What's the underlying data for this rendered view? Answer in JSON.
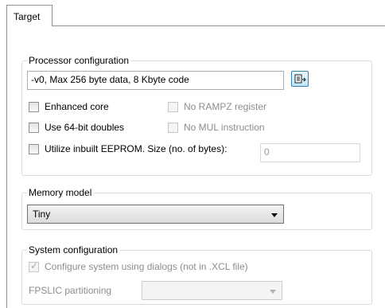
{
  "tab": {
    "label": "Target"
  },
  "processor": {
    "legend": "Processor configuration",
    "value": "-v0, Max 256 byte data, 8 Kbyte code",
    "enhanced_core": "Enhanced core",
    "no_rampz": "No RAMPZ register",
    "use_64bit": "Use 64-bit doubles",
    "no_mul": "No MUL instruction",
    "eeprom_label": "Utilize inbuilt EEPROM. Size (no. of bytes):",
    "eeprom_size": "0"
  },
  "memory": {
    "legend": "Memory model",
    "selected": "Tiny"
  },
  "system": {
    "legend": "System configuration",
    "configure_label": "Configure system using dialogs (not in .XCL file)",
    "fpslic_label": "FPSLIC partitioning",
    "fpslic_selected": ""
  },
  "icons": {
    "processor_select": "select-processor-icon"
  }
}
